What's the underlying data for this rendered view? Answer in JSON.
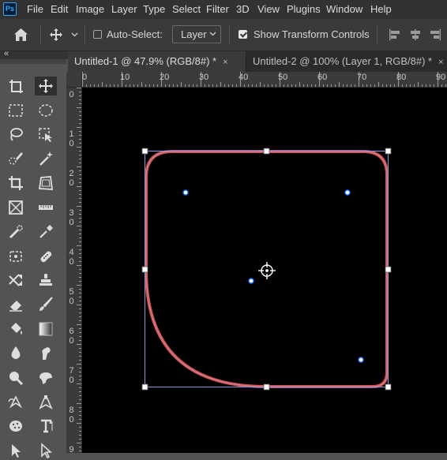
{
  "app": {
    "logo_text": "Ps"
  },
  "menu": [
    "File",
    "Edit",
    "Image",
    "Layer",
    "Type",
    "Select",
    "Filter",
    "3D",
    "View",
    "Plugins",
    "Window",
    "Help"
  ],
  "options": {
    "auto_select_label": "Auto-Select:",
    "auto_select_checked": false,
    "layer_select_value": "Layer",
    "show_transform_label": "Show Transform Controls",
    "show_transform_checked": true
  },
  "tabs": [
    {
      "label": "Untitled-1 @ 47.9% (RGB/8#) *",
      "close": "×",
      "active": true
    },
    {
      "label": "Untitled-2 @ 100% (Layer 1, RGB/8#) *",
      "close": "×",
      "active": false
    }
  ],
  "collapse_glyph": "«",
  "ruler": {
    "h_labels": [
      "0",
      "10",
      "20",
      "30",
      "40",
      "50",
      "60",
      "70",
      "80",
      "90"
    ],
    "v_labels": [
      [
        "0"
      ],
      [
        "1",
        "0"
      ],
      [
        "2",
        "0"
      ],
      [
        "3",
        "0"
      ],
      [
        "4",
        "0"
      ],
      [
        "5",
        "0"
      ],
      [
        "6",
        "0"
      ],
      [
        "7",
        "0"
      ],
      [
        "8",
        "0"
      ],
      [
        "9"
      ]
    ]
  },
  "tools": [
    "artboard-tool-icon",
    "move-tool-icon",
    "rectangular-marquee-icon",
    "elliptical-marquee-icon",
    "lasso-icon",
    "object-selection-icon",
    "quick-selection-icon",
    "magic-wand-icon",
    "crop-icon",
    "perspective-crop-icon",
    "frame-icon",
    "ruler-icon",
    "spot-healing-icon",
    "eyedropper-icon",
    "patch-icon",
    "bandage-icon",
    "content-aware-move-icon",
    "clone-stamp-icon",
    "eraser-icon",
    "brush-icon",
    "paint-bucket-icon",
    "gradient-icon",
    "blur-icon",
    "smudge-icon",
    "dodge-icon",
    "burn-icon",
    "freeform-pen-icon",
    "pen-icon",
    "sponge-icon",
    "type-tool-icon",
    "path-selection-icon",
    "direct-selection-icon"
  ],
  "colors": {
    "shape_stroke": "#c9555c",
    "bounding_box": "#8c98e6",
    "anchor_fill": "#ffffff",
    "canvas": "#000000"
  }
}
